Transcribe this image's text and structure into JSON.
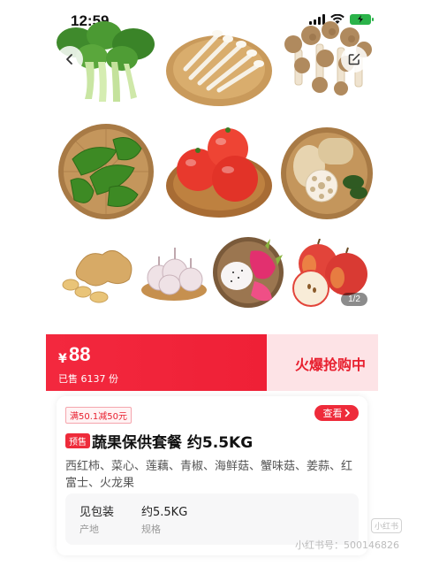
{
  "status_bar": {
    "time": "12:59"
  },
  "gallery": {
    "page_indicator": "1/2",
    "photos": [
      "bok-choy",
      "white-mushrooms",
      "brown-mushrooms",
      "green-peppers",
      "tomatoes",
      "lotus-root",
      "ginger",
      "garlic",
      "dragon-fruit",
      "apples"
    ]
  },
  "price": {
    "currency": "¥",
    "value": "88",
    "sold": "已售 6137 份",
    "hot_label": "火爆抢购中"
  },
  "product": {
    "promo": "满50.1减50元",
    "view_label": "查看",
    "presale": "预售",
    "title": "蔬果保供套餐 约5.5KG",
    "ingredients": "西红柿、菜心、莲藕、青椒、海鲜菇、蟹味菇、姜蒜、红富士、火龙果",
    "specs": [
      {
        "value": "见包装",
        "label": "产地"
      },
      {
        "value": "约5.5KG",
        "label": "规格"
      }
    ]
  },
  "watermark": {
    "text": "小红书号：500146826",
    "logo": "小红书"
  },
  "colors": {
    "accent": "#ee2b3a",
    "banner_right": "#fde3e6",
    "battery": "#2bb34a"
  }
}
